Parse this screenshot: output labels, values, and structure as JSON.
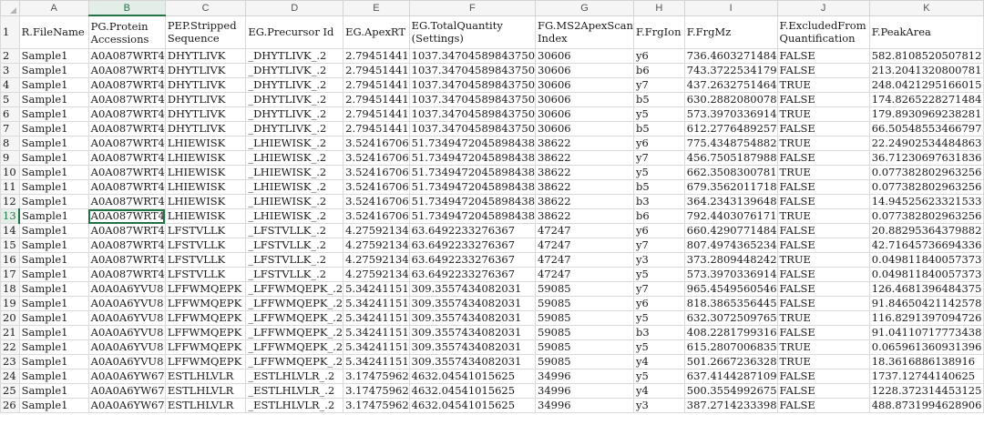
{
  "columns": [
    "A",
    "B",
    "C",
    "D",
    "E",
    "F",
    "G",
    "H",
    "I",
    "J",
    "K"
  ],
  "selected_column": "B",
  "selected_row": 13,
  "headers": [
    "R.FileName",
    "PG.Protein Accessions",
    "PEP.Stripped Sequence",
    "EG.Precursor Id",
    "EG.ApexRT",
    "EG.TotalQuantity (Settings)",
    "FG.MS2ApexScan Index",
    "F.FrgIon",
    "F.FrgMz",
    "F.ExcludedFrom Quantification",
    "F.PeakArea"
  ],
  "rows": [
    {
      "n": "2",
      "cells": [
        "Sample1",
        "A0A087WRT4",
        "DHYTLIVK",
        "_DHYTLIVK_.2",
        "2.79451441",
        "1037.34704589843750",
        "30606",
        "y6",
        "736.4603271484",
        "FALSE",
        "582.8108520507812"
      ]
    },
    {
      "n": "3",
      "cells": [
        "Sample1",
        "A0A087WRT4",
        "DHYTLIVK",
        "_DHYTLIVK_.2",
        "2.79451441",
        "1037.34704589843750",
        "30606",
        "b6",
        "743.3722534179",
        "FALSE",
        "213.2041320800781"
      ]
    },
    {
      "n": "4",
      "cells": [
        "Sample1",
        "A0A087WRT4",
        "DHYTLIVK",
        "_DHYTLIVK_.2",
        "2.79451441",
        "1037.34704589843750",
        "30606",
        "y7",
        "437.2632751464",
        "TRUE",
        "248.0421295166015"
      ]
    },
    {
      "n": "5",
      "cells": [
        "Sample1",
        "A0A087WRT4",
        "DHYTLIVK",
        "_DHYTLIVK_.2",
        "2.79451441",
        "1037.34704589843750",
        "30606",
        "b5",
        "630.2882080078",
        "FALSE",
        "174.8265228271484"
      ]
    },
    {
      "n": "6",
      "cells": [
        "Sample1",
        "A0A087WRT4",
        "DHYTLIVK",
        "_DHYTLIVK_.2",
        "2.79451441",
        "1037.34704589843750",
        "30606",
        "y5",
        "573.3970336914",
        "TRUE",
        "179.8930969238281"
      ]
    },
    {
      "n": "7",
      "cells": [
        "Sample1",
        "A0A087WRT4",
        "DHYTLIVK",
        "_DHYTLIVK_.2",
        "2.79451441",
        "1037.34704589843750",
        "30606",
        "b5",
        "612.2776489257",
        "FALSE",
        "66.50548553466797"
      ]
    },
    {
      "n": "8",
      "cells": [
        "Sample1",
        "A0A087WRT4",
        "LHIEWISK",
        "_LHIEWISK_.2",
        "3.52416706",
        "51.7349472045898438",
        "38622",
        "y6",
        "775.4348754882",
        "TRUE",
        "22.24902534484863"
      ]
    },
    {
      "n": "9",
      "cells": [
        "Sample1",
        "A0A087WRT4",
        "LHIEWISK",
        "_LHIEWISK_.2",
        "3.52416706",
        "51.7349472045898438",
        "38622",
        "y7",
        "456.7505187988",
        "FALSE",
        "36.71230697631836"
      ]
    },
    {
      "n": "10",
      "cells": [
        "Sample1",
        "A0A087WRT4",
        "LHIEWISK",
        "_LHIEWISK_.2",
        "3.52416706",
        "51.7349472045898438",
        "38622",
        "y5",
        "662.3508300781",
        "TRUE",
        "0.077382802963256"
      ]
    },
    {
      "n": "11",
      "cells": [
        "Sample1",
        "A0A087WRT4",
        "LHIEWISK",
        "_LHIEWISK_.2",
        "3.52416706",
        "51.7349472045898438",
        "38622",
        "b5",
        "679.3562011718",
        "FALSE",
        "0.077382802963256"
      ]
    },
    {
      "n": "12",
      "cells": [
        "Sample1",
        "A0A087WRT4",
        "LHIEWISK",
        "_LHIEWISK_.2",
        "3.52416706",
        "51.7349472045898438",
        "38622",
        "b3",
        "364.2343139648",
        "FALSE",
        "14.94525623321533"
      ]
    },
    {
      "n": "13",
      "cells": [
        "Sample1",
        "A0A087WRT4",
        "LHIEWISK",
        "_LHIEWISK_.2",
        "3.52416706",
        "51.7349472045898438",
        "38622",
        "b6",
        "792.4403076171",
        "TRUE",
        "0.077382802963256"
      ]
    },
    {
      "n": "14",
      "cells": [
        "Sample1",
        "A0A087WRT4",
        "LFSTVLLK",
        "_LFSTVLLK_.2",
        "4.27592134",
        "63.6492233276367",
        "47247",
        "y6",
        "660.4290771484",
        "FALSE",
        "20.88295364379882"
      ]
    },
    {
      "n": "15",
      "cells": [
        "Sample1",
        "A0A087WRT4",
        "LFSTVLLK",
        "_LFSTVLLK_.2",
        "4.27592134",
        "63.6492233276367",
        "47247",
        "y7",
        "807.4974365234",
        "FALSE",
        "42.71645736694336"
      ]
    },
    {
      "n": "16",
      "cells": [
        "Sample1",
        "A0A087WRT4",
        "LFSTVLLK",
        "_LFSTVLLK_.2",
        "4.27592134",
        "63.6492233276367",
        "47247",
        "y3",
        "373.2809448242",
        "TRUE",
        "0.049811840057373"
      ]
    },
    {
      "n": "17",
      "cells": [
        "Sample1",
        "A0A087WRT4",
        "LFSTVLLK",
        "_LFSTVLLK_.2",
        "4.27592134",
        "63.6492233276367",
        "47247",
        "y5",
        "573.3970336914",
        "FALSE",
        "0.049811840057373"
      ]
    },
    {
      "n": "18",
      "cells": [
        "Sample1",
        "A0A0A6YVU8",
        "LFFWMQEPK",
        "_LFFWMQEPK_.2",
        "5.34241151",
        "309.3557434082031",
        "59085",
        "y7",
        "965.4549560546",
        "FALSE",
        "126.4681396484375"
      ]
    },
    {
      "n": "19",
      "cells": [
        "Sample1",
        "A0A0A6YVU8",
        "LFFWMQEPK",
        "_LFFWMQEPK_.2",
        "5.34241151",
        "309.3557434082031",
        "59085",
        "y6",
        "818.3865356445",
        "FALSE",
        "91.84650421142578"
      ]
    },
    {
      "n": "20",
      "cells": [
        "Sample1",
        "A0A0A6YVU8",
        "LFFWMQEPK",
        "_LFFWMQEPK_.2",
        "5.34241151",
        "309.3557434082031",
        "59085",
        "y5",
        "632.3072509765",
        "TRUE",
        "116.8291397094726"
      ]
    },
    {
      "n": "21",
      "cells": [
        "Sample1",
        "A0A0A6YVU8",
        "LFFWMQEPK",
        "_LFFWMQEPK_.2",
        "5.34241151",
        "309.3557434082031",
        "59085",
        "b3",
        "408.2281799316",
        "FALSE",
        "91.04110717773438"
      ]
    },
    {
      "n": "22",
      "cells": [
        "Sample1",
        "A0A0A6YVU8",
        "LFFWMQEPK",
        "_LFFWMQEPK_.2",
        "5.34241151",
        "309.3557434082031",
        "59085",
        "y5",
        "615.2807006835",
        "TRUE",
        "0.065961360931396"
      ]
    },
    {
      "n": "23",
      "cells": [
        "Sample1",
        "A0A0A6YVU8",
        "LFFWMQEPK",
        "_LFFWMQEPK_.2",
        "5.34241151",
        "309.3557434082031",
        "59085",
        "y4",
        "501.2667236328",
        "TRUE",
        "18.3616886138916"
      ]
    },
    {
      "n": "24",
      "cells": [
        "Sample1",
        "A0A0A6YW67",
        "ESTLHLVLR",
        "_ESTLHLVLR_.2",
        "3.17475962",
        "4632.04541015625",
        "34996",
        "y5",
        "637.4144287109",
        "FALSE",
        "1737.12744140625"
      ]
    },
    {
      "n": "25",
      "cells": [
        "Sample1",
        "A0A0A6YW67",
        "ESTLHLVLR",
        "_ESTLHLVLR_.2",
        "3.17475962",
        "4632.04541015625",
        "34996",
        "y4",
        "500.3554992675",
        "FALSE",
        "1228.372314453125"
      ]
    },
    {
      "n": "26",
      "cells": [
        "Sample1",
        "A0A0A6YW67",
        "ESTLHLVLR",
        "_ESTLHLVLR_.2",
        "3.17475962",
        "4632.04541015625",
        "34996",
        "y3",
        "387.2714233398",
        "FALSE",
        "488.8731994628906"
      ]
    }
  ]
}
